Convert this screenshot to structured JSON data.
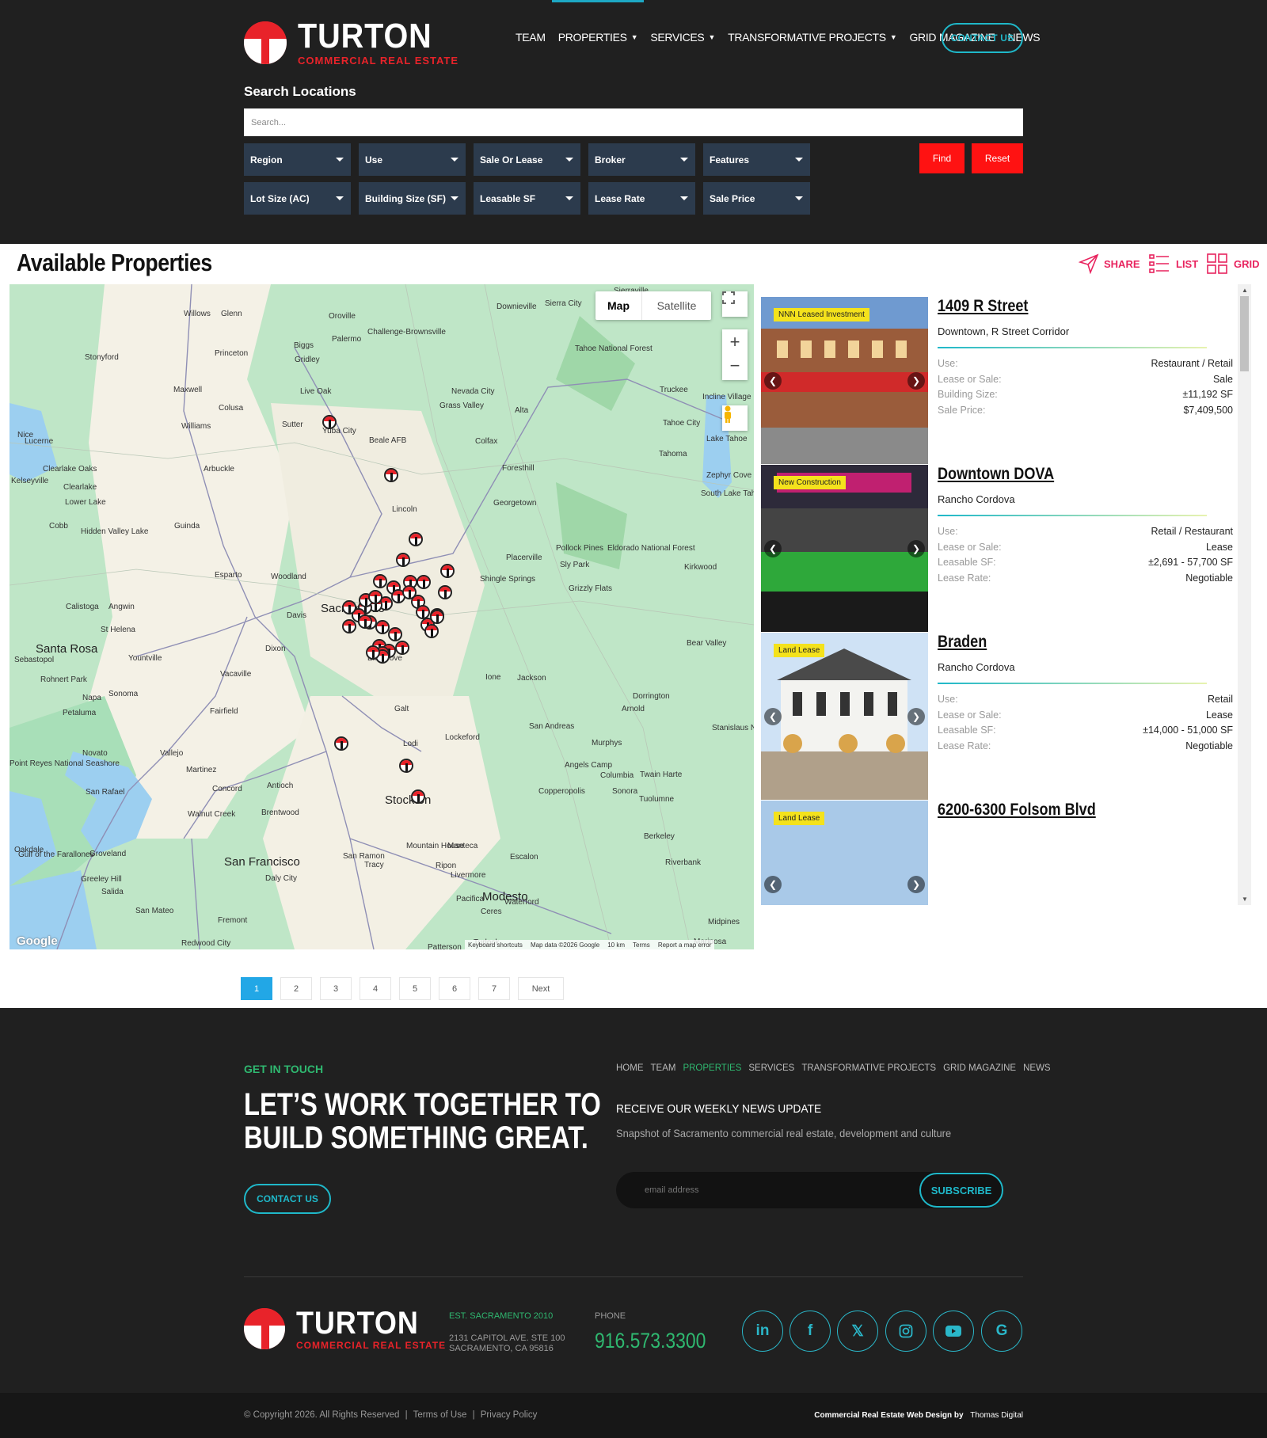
{
  "brand": {
    "name": "TURTON",
    "tagline": "COMMERCIAL REAL ESTATE"
  },
  "nav": {
    "items": [
      {
        "label": "TEAM",
        "caret": false
      },
      {
        "label": "PROPERTIES",
        "caret": true
      },
      {
        "label": "SERVICES",
        "caret": true
      },
      {
        "label": "TRANSFORMATIVE PROJECTS",
        "caret": true
      },
      {
        "label": "GRID MAGAZINE",
        "caret": false
      },
      {
        "label": "NEWS",
        "caret": false
      }
    ],
    "contact": "CONTACT US"
  },
  "search": {
    "label": "Search Locations",
    "placeholder": "Search...",
    "filters_row1": [
      "Region",
      "Use",
      "Sale Or Lease",
      "Broker",
      "Features"
    ],
    "filters_row2": [
      "Lot Size (AC)",
      "Building Size (SF)",
      "Leasable SF",
      "Lease Rate",
      "Sale Price"
    ],
    "find": "Find",
    "reset": "Reset"
  },
  "main": {
    "title": "Available Properties",
    "share": "SHARE",
    "list": "LIST",
    "grid": "GRID"
  },
  "map": {
    "type_map": "Map",
    "type_satellite": "Satellite",
    "zoom_in": "+",
    "zoom_out": "−",
    "attribution": "Google",
    "footer": [
      "Keyboard shortcuts",
      "Map data ©2026 Google",
      "10 km",
      "Terms",
      "Report a map error"
    ],
    "labels": [
      "Willows",
      "Glenn",
      "Oroville",
      "Downieville",
      "Sierra City",
      "Sierraville",
      "Stonyford",
      "Princeton",
      "Biggs",
      "Gridley",
      "Palermo",
      "Challenge-Brownsville",
      "Tahoe National Forest",
      "Maxwell",
      "Live Oak",
      "Truckee",
      "Colusa",
      "Nevada City",
      "Grass Valley",
      "Alta",
      "Incline Village",
      "Williams",
      "Sutter",
      "Yuba City",
      "Beale AFB",
      "Tahoe City",
      "Colfax",
      "Tahoma",
      "Lake Tahoe",
      "Lucerne",
      "Nice",
      "Arbuckle",
      "Foresthill",
      "Zephyr Cove",
      "Clearlake Oaks",
      "Clearlake",
      "South Lake Tahoe",
      "Kelseyville",
      "Lower Lake",
      "Lincoln",
      "Georgetown",
      "Cobb",
      "Hidden Valley Lake",
      "Guinda",
      "Pollock Pines",
      "Eldorado National Forest",
      "Placerville",
      "Sly Park",
      "Kirkwood",
      "Esparto",
      "Woodland",
      "Shingle Springs",
      "Grizzly Flats",
      "Calistoga",
      "Angwin",
      "Davis",
      "Sacramento",
      "St Helena",
      "Santa Rosa",
      "Sebastopol",
      "Yountville",
      "Dixon",
      "Bear Valley",
      "Rohnert Park",
      "Vacaville",
      "Elk Grove",
      "Ione",
      "Jackson",
      "Napa",
      "Sonoma",
      "Fairfield",
      "Dorrington",
      "Petaluma",
      "Galt",
      "Arnold",
      "San Andreas",
      "Novato",
      "Vallejo",
      "Lodi",
      "Lockeford",
      "Murphys",
      "Stanislaus National Forest",
      "Point Reyes National Seashore",
      "Martinez",
      "Concord",
      "Antioch",
      "Angels Camp",
      "Columbia",
      "Twain Harte",
      "San Rafael",
      "Copperopolis",
      "Sonora",
      "Tuolumne",
      "Walnut Creek",
      "Brentwood",
      "Stockton",
      "Berkeley",
      "Groveland",
      "San Francisco",
      "San Ramon",
      "Mountain House",
      "Manteca",
      "Escalon",
      "Oakdale",
      "Tracy",
      "Ripon",
      "Riverbank",
      "Greeley Hill",
      "Daly City",
      "Livermore",
      "Salida",
      "Pacifica",
      "Modesto",
      "Waterford",
      "Ceres",
      "Midpines",
      "San Mateo",
      "Fremont",
      "Redwood City",
      "Turlock",
      "Patterson",
      "Mariposa",
      "Gulf of the Farallones"
    ]
  },
  "properties": [
    {
      "badge": "NNN Leased Investment",
      "title": "1409 R Street",
      "location": "Downtown, R Street Corridor",
      "rows": [
        [
          "Use:",
          "Restaurant / Retail"
        ],
        [
          "Lease or Sale:",
          "Sale"
        ],
        [
          "Building Size:",
          "±11,192 SF"
        ],
        [
          "Sale Price:",
          "$7,409,500"
        ]
      ]
    },
    {
      "badge": "New Construction",
      "title": "Downtown DOVA",
      "location": "Rancho Cordova",
      "rows": [
        [
          "Use:",
          "Retail / Restaurant"
        ],
        [
          "Lease or Sale:",
          "Lease"
        ],
        [
          "Leasable SF:",
          "±2,691 - 57,700 SF"
        ],
        [
          "Lease Rate:",
          "Negotiable"
        ]
      ]
    },
    {
      "badge": "Land Lease",
      "title": "Braden",
      "location": "Rancho Cordova",
      "rows": [
        [
          "Use:",
          "Retail"
        ],
        [
          "Lease or Sale:",
          "Lease"
        ],
        [
          "Leasable SF:",
          "±14,000 - 51,000 SF"
        ],
        [
          "Lease Rate:",
          "Negotiable"
        ]
      ]
    },
    {
      "badge": "Land Lease",
      "title": "6200-6300 Folsom Blvd",
      "location": "",
      "rows": []
    }
  ],
  "pagination": {
    "pages": [
      "1",
      "2",
      "3",
      "4",
      "5",
      "6",
      "7"
    ],
    "next": "Next",
    "current": "1"
  },
  "footer": {
    "eyebrow": "GET IN TOUCH",
    "headline1": "LET’S WORK TOGETHER TO",
    "headline2": "BUILD SOMETHING GREAT.",
    "contact": "CONTACT US",
    "links": [
      "HOME",
      "TEAM",
      "PROPERTIES",
      "SERVICES",
      "TRANSFORMATIVE PROJECTS",
      "GRID MAGAZINE",
      "NEWS"
    ],
    "news_title": "RECEIVE OUR WEEKLY NEWS UPDATE",
    "news_sub": "Snapshot of Sacramento commercial real estate, development and culture",
    "email_placeholder": "email address",
    "subscribe": "SUBSCRIBE",
    "est": "EST. SACRAMENTO 2010",
    "addr1": "2131 CAPITOL AVE. STE 100",
    "addr2": "SACRAMENTO, CA 95816",
    "phone_label": "PHONE",
    "phone": "916.573.3300",
    "social": [
      "linkedin",
      "facebook",
      "x",
      "instagram",
      "youtube",
      "google"
    ],
    "copyright": "© Copyright 2026. All Rights Reserved",
    "terms": "Terms of Use",
    "privacy": "Privacy Policy",
    "credit": "Commercial Real Estate Web Design by",
    "credit_name": "Thomas Digital"
  },
  "colors": {
    "accent": "#1fb8c9",
    "brand_red": "#e8232a",
    "pink": "#e8235e",
    "header_bg": "#202020",
    "active_page": "#22a7e6"
  }
}
